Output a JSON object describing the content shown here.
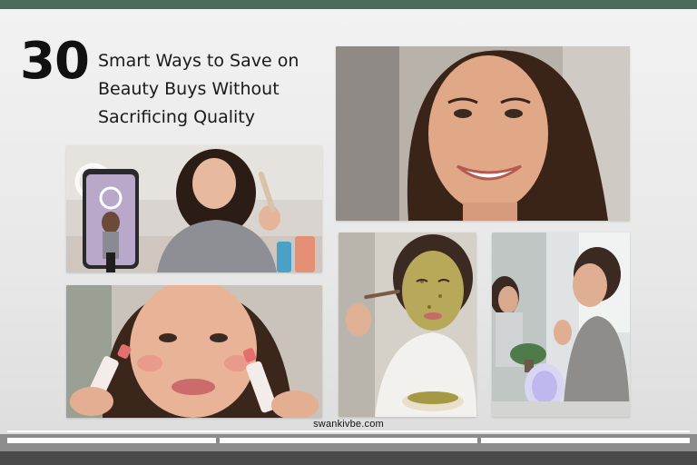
{
  "title": {
    "number": "30",
    "lines": [
      "Smart Ways to Save on",
      "Beauty Buys Without",
      "Sacrificing Quality"
    ]
  },
  "footer": {
    "site": "swankivbe.com"
  },
  "images": [
    {
      "icon": "woman-filming-makeup-with-phone-photo"
    },
    {
      "icon": "smiling-woman-portrait-photo"
    },
    {
      "icon": "woman-holding-lipsticks-photo"
    },
    {
      "icon": "woman-applying-face-mask-photo"
    },
    {
      "icon": "woman-with-led-mask-photo"
    }
  ],
  "colors": {
    "top_band": "#4b6a5c",
    "footer_bar": "#4a4a4a"
  }
}
